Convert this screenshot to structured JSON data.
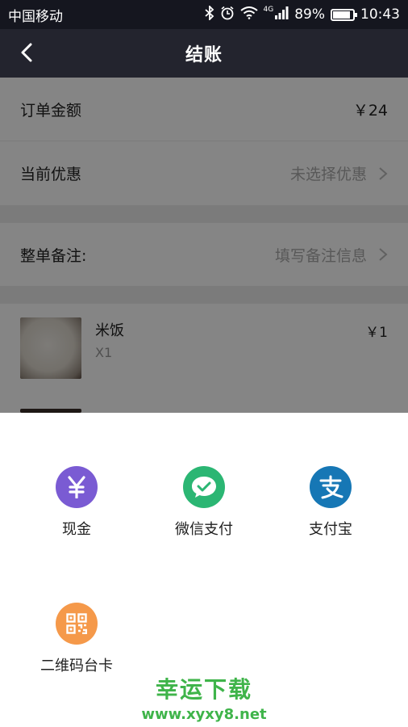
{
  "status_bar": {
    "carrier": "中国移动",
    "network": "4G",
    "battery": "89%",
    "battery_level": 0.89,
    "time": "10:43"
  },
  "header": {
    "title": "结账"
  },
  "order": {
    "amount_label": "订单金额",
    "amount_value": "￥24",
    "discount_label": "当前优惠",
    "discount_hint": "未选择优惠",
    "note_label": "整单备注:",
    "note_hint": "填写备注信息"
  },
  "items": [
    {
      "name": "米饭",
      "qty": "X1",
      "price": "￥1"
    }
  ],
  "payment_methods": [
    {
      "label": "现金",
      "icon": "yen-icon",
      "color": "#7a5bd3"
    },
    {
      "label": "微信支付",
      "icon": "wechat-icon",
      "color": "#2bb673"
    },
    {
      "label": "支付宝",
      "icon": "alipay-icon",
      "color": "#1677b5"
    },
    {
      "label": "二维码台卡",
      "icon": "qrcode-icon",
      "color": "#f5994a"
    }
  ],
  "watermark": {
    "title": "幸运下载",
    "url": "www.xyxy8.net"
  }
}
